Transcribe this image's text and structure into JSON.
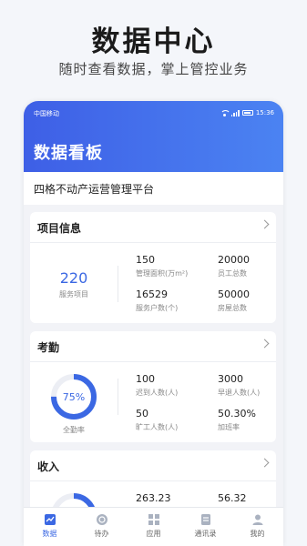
{
  "promo": {
    "title": "数据中心",
    "subtitle": "随时查看数据，掌上管控业务"
  },
  "status_bar": {
    "carrier": "中国移动",
    "time": "15:36"
  },
  "header": {
    "title": "数据看板"
  },
  "org": {
    "name": "四格不动产运营管理平台"
  },
  "project_card": {
    "title": "项目信息",
    "main_value": "220",
    "main_label": "服务项目",
    "stats": [
      {
        "value": "150",
        "label": "管理面积(万m²)"
      },
      {
        "value": "20000",
        "label": "员工总数"
      },
      {
        "value": "16529",
        "label": "服务户数(个)"
      },
      {
        "value": "50000",
        "label": "房屋总数"
      }
    ]
  },
  "attendance_card": {
    "title": "考勤",
    "ring_value": "75%",
    "ring_fraction": 0.75,
    "ring_label": "全勤率",
    "stats": [
      {
        "value": "100",
        "label": "迟到人数(人)"
      },
      {
        "value": "3000",
        "label": "早退人数(人)"
      },
      {
        "value": "50",
        "label": "旷工人数(人)"
      },
      {
        "value": "50.30%",
        "label": "加班率"
      }
    ]
  },
  "income_card": {
    "title": "收入",
    "stats": [
      {
        "value": "263.23"
      },
      {
        "value": "56.32"
      }
    ]
  },
  "tabbar": {
    "items": [
      {
        "label": "数据",
        "icon": "chart-icon",
        "active": true
      },
      {
        "label": "待办",
        "icon": "todo-icon",
        "active": false
      },
      {
        "label": "应用",
        "icon": "grid-icon",
        "active": false
      },
      {
        "label": "通讯录",
        "icon": "contacts-icon",
        "active": false
      },
      {
        "label": "我的",
        "icon": "user-icon",
        "active": false
      }
    ]
  },
  "colors": {
    "accent": "#3b68e3",
    "header_gradient_start": "#3e5fe6",
    "header_gradient_end": "#4b83f2"
  }
}
